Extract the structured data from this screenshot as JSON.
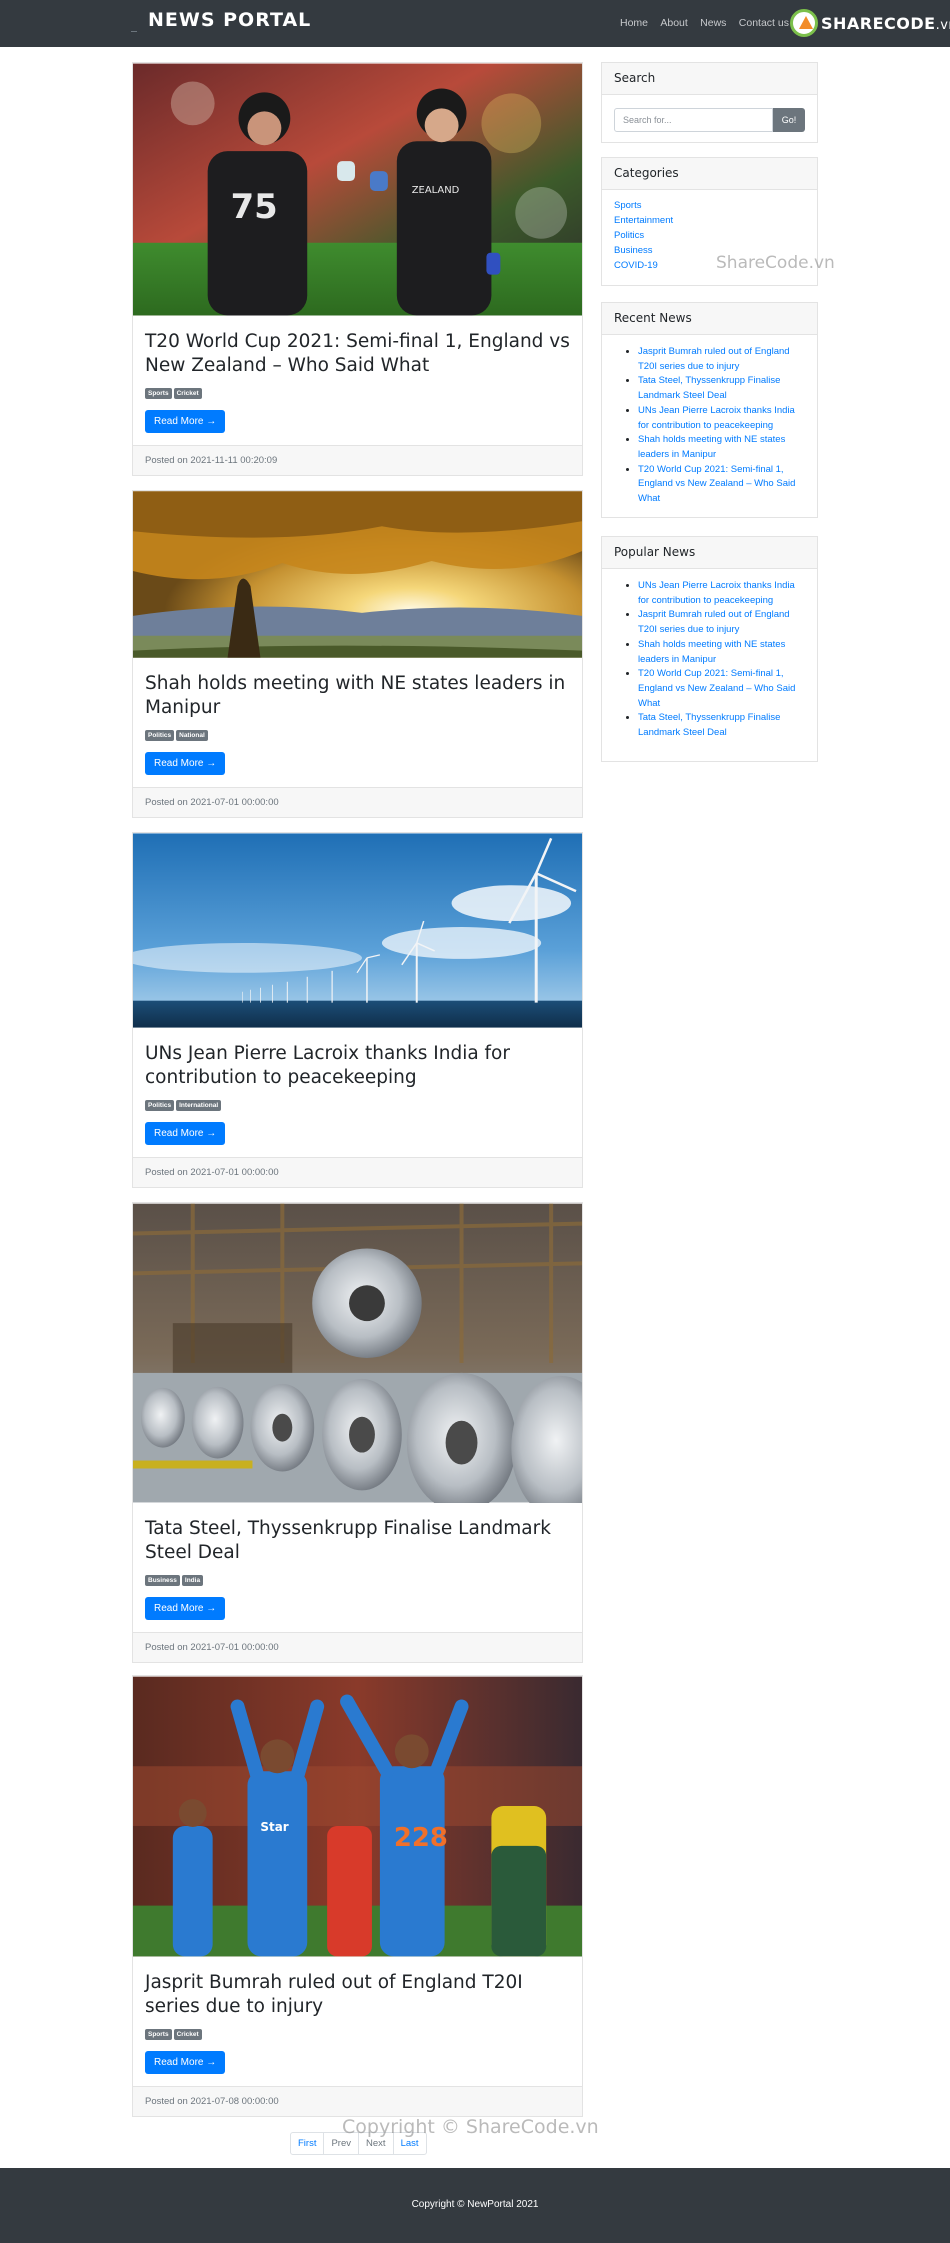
{
  "navbar": {
    "brand": "NEWS PORTAL",
    "links": [
      "Home",
      "About",
      "News",
      "Contact us"
    ],
    "logo": {
      "text": "SHARECODE",
      "suffix": ".vn",
      "icon": "sharecode-logo-icon"
    }
  },
  "posts": [
    {
      "title": "T20 World Cup 2021: Semi-final 1, England vs New Zealand – Who Said What",
      "tags": [
        "Sports",
        "Cricket"
      ],
      "read_more": "Read More →",
      "posted": "Posted on 2021-11-11 00:20:09",
      "image": "cricket-players-fist-bump-image"
    },
    {
      "title": "Shah holds meeting with NE states leaders in Manipur",
      "tags": [
        "Politics",
        "National"
      ],
      "read_more": "Read More →",
      "posted": "Posted on 2021-07-01 00:00:00",
      "image": "autumn-tree-sunset-image"
    },
    {
      "title": "UNs Jean Pierre Lacroix thanks India for contribution to peacekeeping",
      "tags": [
        "Politics",
        "International"
      ],
      "read_more": "Read More →",
      "posted": "Posted on 2021-07-01 00:00:00",
      "image": "wind-turbines-sea-image"
    },
    {
      "title": "Tata Steel, Thyssenkrupp Finalise Landmark Steel Deal",
      "tags": [
        "Business",
        "India"
      ],
      "read_more": "Read More →",
      "posted": "Posted on 2021-07-01 00:00:00",
      "image": "steel-coils-factory-image"
    },
    {
      "title": "Jasprit Bumrah ruled out of England T20I series due to injury",
      "tags": [
        "Sports",
        "Cricket"
      ],
      "read_more": "Read More →",
      "posted": "Posted on 2021-07-08 00:00:00",
      "image": "india-cricket-celebration-image"
    }
  ],
  "sidebar": {
    "search": {
      "title": "Search",
      "placeholder": "Search for...",
      "button": "Go!"
    },
    "categories": {
      "title": "Categories",
      "items": [
        "Sports",
        "Entertainment",
        "Politics",
        "Business",
        "COVID-19"
      ]
    },
    "recent": {
      "title": "Recent News",
      "items": [
        "Jasprit Bumrah ruled out of England T20I series due to injury",
        "Tata Steel, Thyssenkrupp Finalise Landmark Steel Deal",
        "UNs Jean Pierre Lacroix thanks India for contribution to peacekeeping",
        "Shah holds meeting with NE states leaders in Manipur",
        "T20 World Cup 2021: Semi-final 1, England vs New Zealand – Who Said What"
      ]
    },
    "popular": {
      "title": "Popular News",
      "items": [
        "UNs Jean Pierre Lacroix thanks India for contribution to peacekeeping",
        "Jasprit Bumrah ruled out of England T20I series due to injury",
        "Shah holds meeting with NE states leaders in Manipur",
        "T20 World Cup 2021: Semi-final 1, England vs New Zealand – Who Said What",
        "Tata Steel, Thyssenkrupp Finalise Landmark Steel Deal"
      ]
    }
  },
  "pagination": [
    "First",
    "Prev",
    "Next",
    "Last"
  ],
  "watermarks": [
    "ShareCode.vn",
    "Copyright © ShareCode.vn"
  ],
  "footer": {
    "copyright": "Copyright © NewPortal 2021"
  }
}
